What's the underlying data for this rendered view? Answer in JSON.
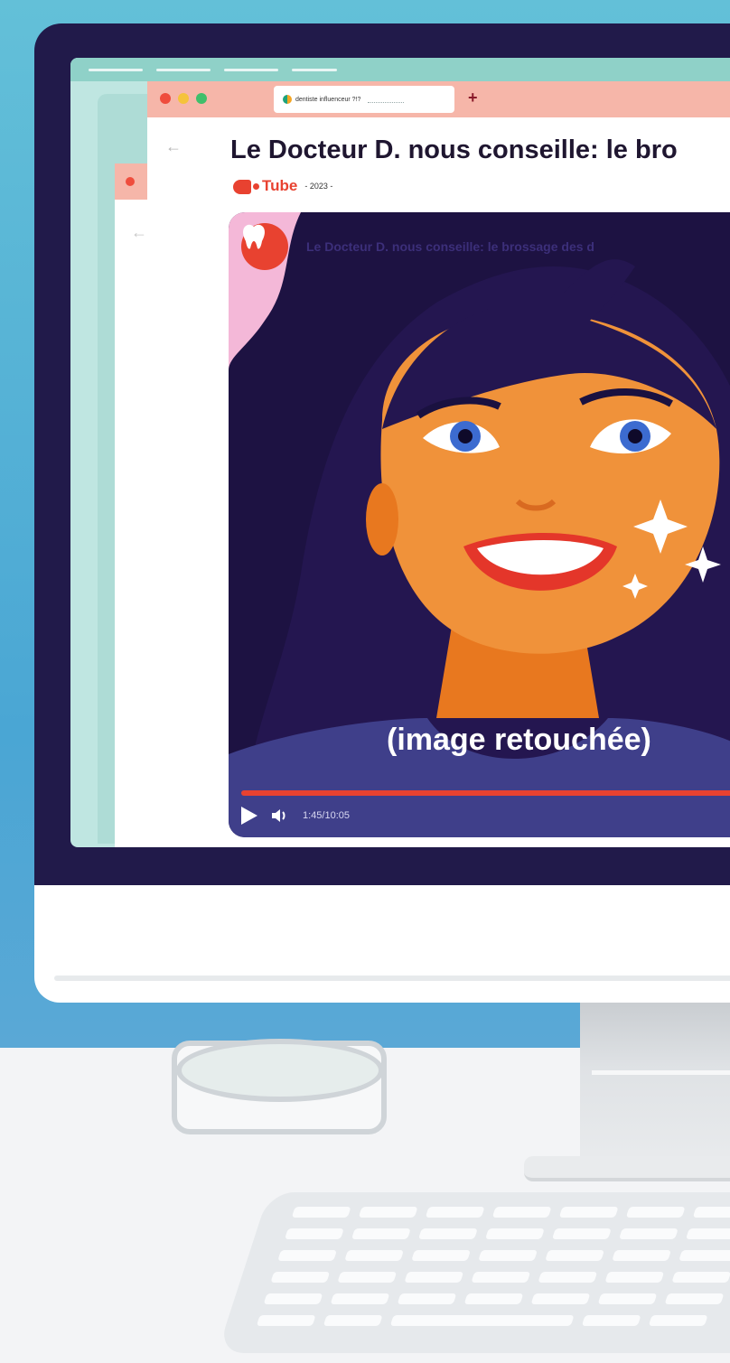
{
  "browser": {
    "tab_title": "dentiste influenceur ?!?",
    "new_tab_label": "+",
    "back_arrow": "←"
  },
  "page": {
    "title": "Le Docteur D. nous conseille: le bro",
    "source_name": "Tube",
    "date": "- 2023 -"
  },
  "video": {
    "title": "Le Docteur D. nous conseille: le brossage des d",
    "caption": "(image retouchée)",
    "time": "1:45/10:05",
    "progress_fraction": 1.0
  },
  "colors": {
    "accent": "#e84230",
    "wall": "#4aa6d4",
    "monitor": "#211a4a",
    "hair": "#1d1242",
    "skin": "#f0923a",
    "shirt": "#3f3f8a"
  }
}
